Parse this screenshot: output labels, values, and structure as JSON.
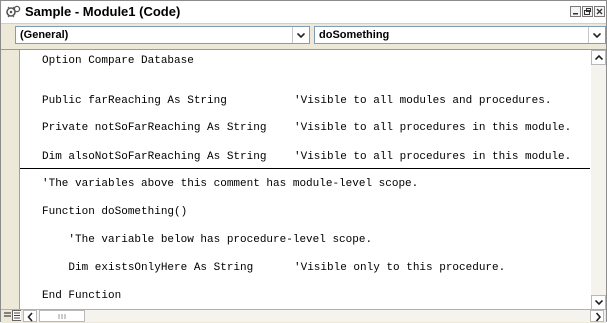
{
  "window": {
    "title": "Sample - Module1 (Code)",
    "icon": "module-icon"
  },
  "object_combo": {
    "value": "(General)"
  },
  "procedure_combo": {
    "value": "doSomething"
  },
  "code_lines": [
    {
      "code": "Option Compare Database",
      "comment": ""
    },
    {
      "code": "Public farReaching As String",
      "comment": "'Visible to all modules and procedures."
    },
    {
      "code": "Private notSoFarReaching As String",
      "comment": "'Visible to all procedures in this module."
    },
    {
      "code": "Dim alsoNotSoFarReaching As String",
      "comment": "'Visible to all procedures in this module."
    },
    {
      "code": "'The variables above this comment has module-level scope.",
      "comment": ""
    },
    {
      "code": "Function doSomething()",
      "comment": ""
    },
    {
      "code": "    'The variable below has procedure-level scope.",
      "comment": ""
    },
    {
      "code": "    Dim existsOnlyHere As String",
      "comment": "'Visible only to this procedure."
    },
    {
      "code": "End Function",
      "comment": ""
    }
  ],
  "colors": {
    "frame": "#ece9d8",
    "code_bg": "#ffffff",
    "combo_border": "#7f9db9"
  }
}
